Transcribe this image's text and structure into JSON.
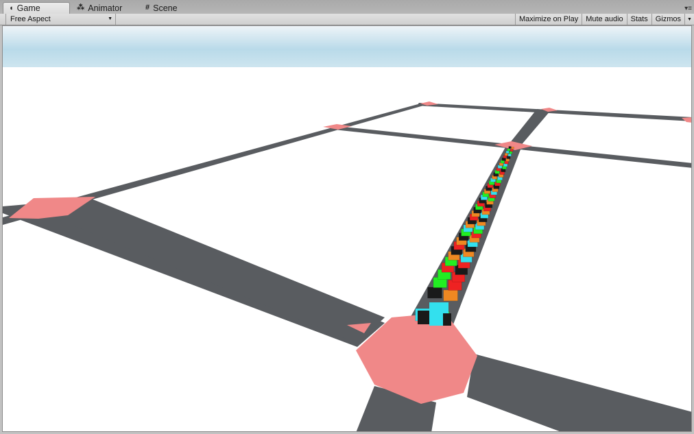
{
  "tabs": [
    {
      "label": "Game",
      "icon": "pacman-icon"
    },
    {
      "label": "Animator",
      "icon": "animator-icon"
    },
    {
      "label": "Scene",
      "icon": "scene-grid-icon"
    }
  ],
  "toolbar": {
    "aspect": "Free Aspect",
    "maximize_on_play": "Maximize on Play",
    "mute_audio": "Mute audio",
    "stats": "Stats",
    "gizmos": "Gizmos"
  },
  "scene": {
    "colors": {
      "sky_top": "#a8cfe2",
      "ground": "#ffffff",
      "road": "#595c60",
      "junction": "#f08888"
    },
    "vehicle_colors": [
      "#22ee22",
      "#ee8822",
      "#ee2222",
      "#33e0ee",
      "#1a1a1a"
    ]
  }
}
